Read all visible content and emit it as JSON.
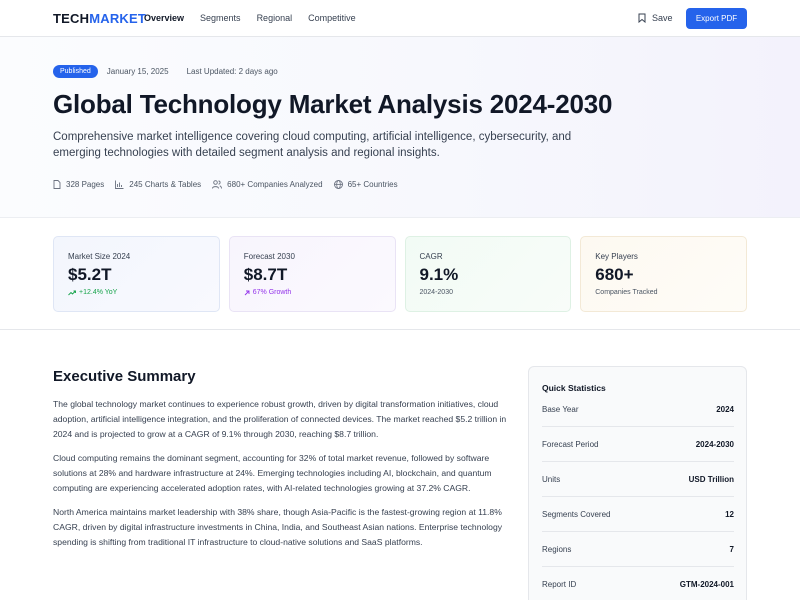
{
  "nav": {
    "logo_part1": "TECH",
    "logo_part2": "MARKET",
    "links": [
      "Overview",
      "Segments",
      "Regional",
      "Competitive"
    ],
    "save_label": "Save",
    "export_label": "Export PDF"
  },
  "hero": {
    "badge": "Published",
    "date": "January 15, 2025",
    "updated": "Last Updated: 2 days ago",
    "title": "Global Technology Market Analysis 2024-2030",
    "subtitle": "Comprehensive market intelligence covering cloud computing, artificial intelligence, cybersecurity, and emerging technologies with detailed segment analysis and regional insights.",
    "stats": [
      "328 Pages",
      "245 Charts & Tables",
      "680+ Companies Analyzed",
      "65+ Countries"
    ]
  },
  "metrics": [
    {
      "label": "Market Size 2024",
      "value": "$5.2T",
      "sub": "+12.4% YoY"
    },
    {
      "label": "Forecast 2030",
      "value": "$8.7T",
      "sub": "67% Growth"
    },
    {
      "label": "CAGR",
      "value": "9.1%",
      "sub": "2024-2030"
    },
    {
      "label": "Key Players",
      "value": "680+",
      "sub": "Companies Tracked"
    }
  ],
  "summary": {
    "title": "Executive Summary",
    "paragraphs": [
      "The global technology market continues to experience robust growth, driven by digital transformation initiatives, cloud adoption, artificial intelligence integration, and the proliferation of connected devices. The market reached $5.2 trillion in 2024 and is projected to grow at a CAGR of 9.1% through 2030, reaching $8.7 trillion.",
      "Cloud computing remains the dominant segment, accounting for 32% of total market revenue, followed by software solutions at 28% and hardware infrastructure at 24%. Emerging technologies including AI, blockchain, and quantum computing are experiencing accelerated adoption rates, with AI-related technologies growing at 37.2% CAGR.",
      "North America maintains market leadership with 38% share, though Asia-Pacific is the fastest-growing region at 11.8% CAGR, driven by digital infrastructure investments in China, India, and Southeast Asian nations. Enterprise technology spending is shifting from traditional IT infrastructure to cloud-native solutions and SaaS platforms."
    ]
  },
  "quick_stats": {
    "title": "Quick Statistics",
    "rows": [
      {
        "label": "Base Year",
        "value": "2024"
      },
      {
        "label": "Forecast Period",
        "value": "2024-2030"
      },
      {
        "label": "Units",
        "value": "USD Trillion"
      },
      {
        "label": "Segments Covered",
        "value": "12"
      },
      {
        "label": "Regions",
        "value": "7"
      },
      {
        "label": "Report ID",
        "value": "GTM-2024-001"
      }
    ]
  },
  "colors": {
    "primary": "#2563eb",
    "growth_green": "#16a34a",
    "growth_purple": "#9333ea"
  }
}
